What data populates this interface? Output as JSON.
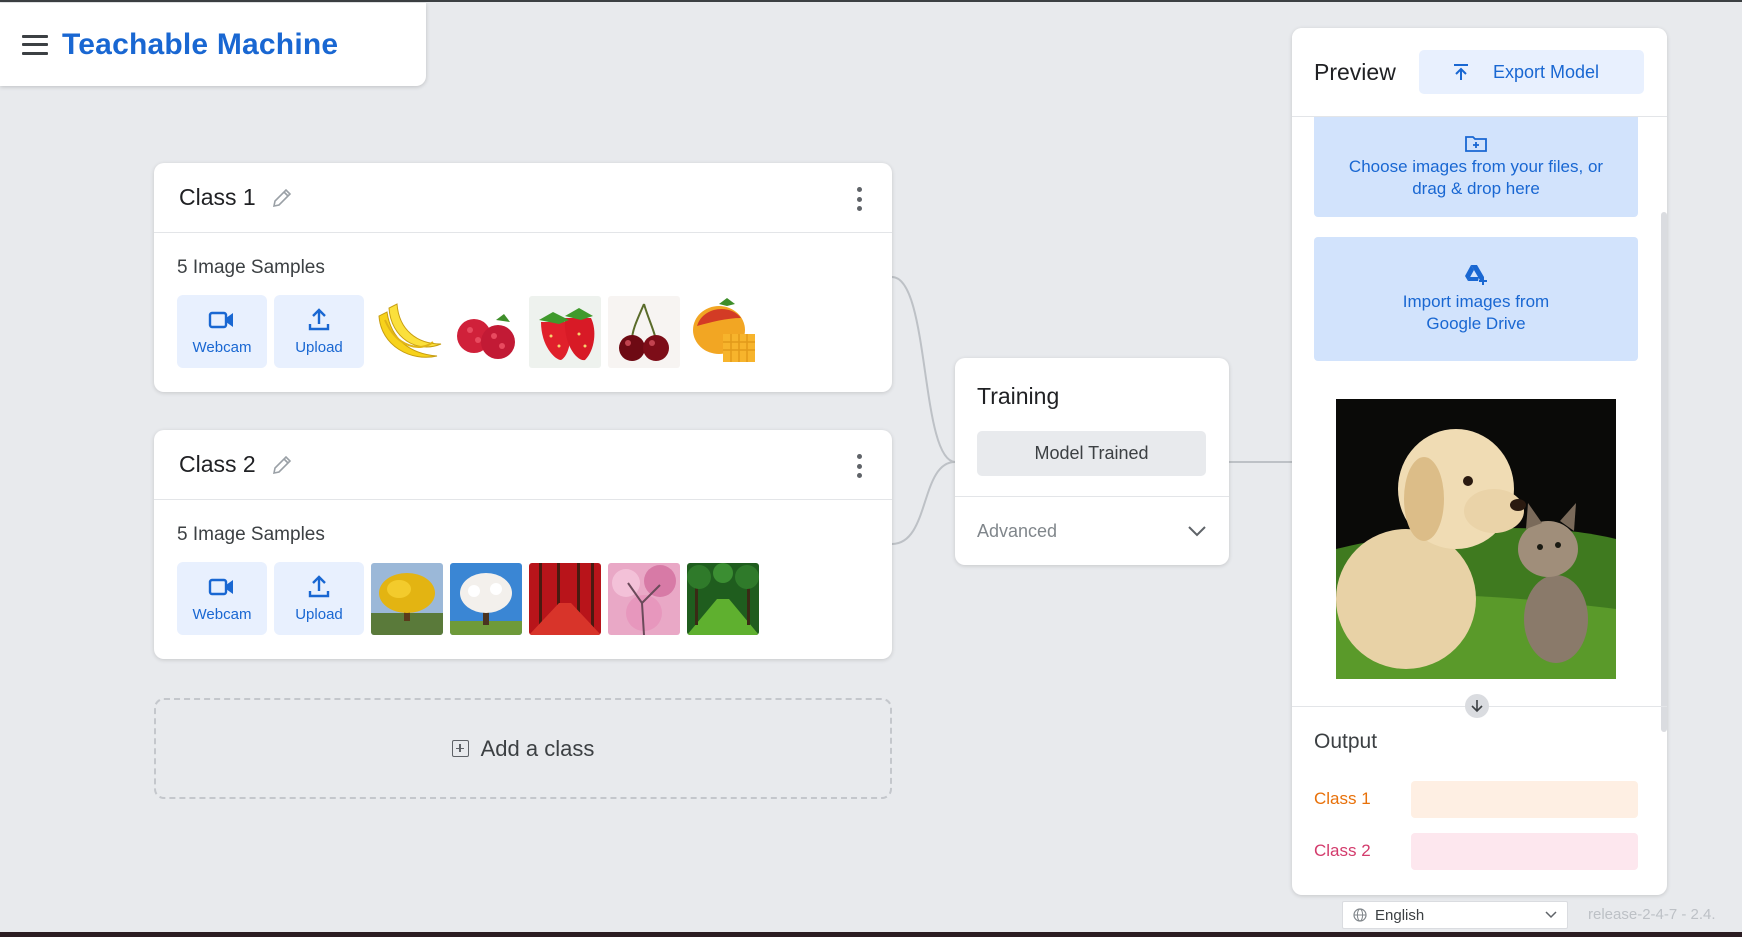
{
  "app": {
    "title": "Teachable Machine"
  },
  "colors": {
    "accent": "#1967d2",
    "class1": "#e8710a",
    "class2": "#d33b6c",
    "class1_bar": "#feefe3",
    "class2_bar": "#fde7ee"
  },
  "classes": [
    {
      "name": "Class 1",
      "samples_label": "5 Image Samples",
      "webcam_label": "Webcam",
      "upload_label": "Upload",
      "thumbnails": [
        "banana",
        "raspberries",
        "strawberries",
        "cherries",
        "mango"
      ]
    },
    {
      "name": "Class 2",
      "samples_label": "5 Image Samples",
      "webcam_label": "Webcam",
      "upload_label": "Upload",
      "thumbnails": [
        "yellow-tree",
        "white-blossom-tree",
        "red-forest",
        "pink-blossom",
        "green-tree-lane"
      ]
    }
  ],
  "add_class_label": "Add a class",
  "training": {
    "title": "Training",
    "status_button": "Model Trained",
    "advanced_label": "Advanced"
  },
  "preview": {
    "title": "Preview",
    "export_label": "Export Model",
    "drop_text": "Choose images from your files, or drag & drop here",
    "drive_text": "Import images from Google Drive",
    "image": "puppy-and-kitten",
    "output_title": "Output",
    "outputs": [
      {
        "label": "Class 1",
        "value": 0
      },
      {
        "label": "Class 2",
        "value": 0
      }
    ]
  },
  "footer": {
    "language": "English",
    "release": "release-2-4-7 - 2.4."
  }
}
